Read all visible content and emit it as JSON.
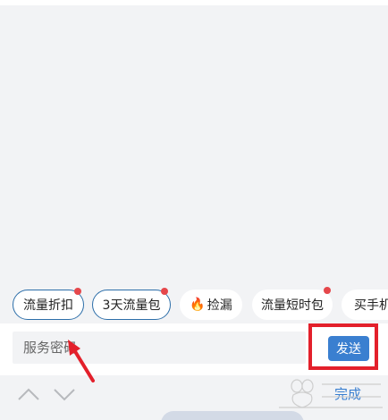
{
  "quick_replies": [
    {
      "label": "流量折扣",
      "has_dot": true
    },
    {
      "label": "3天流量包",
      "has_dot": true
    },
    {
      "label": "捡漏",
      "icon": "fire-icon"
    },
    {
      "label": "流量短时包",
      "has_dot": true
    },
    {
      "label": "买手机"
    }
  ],
  "input": {
    "placeholder": "服务密码",
    "value": ""
  },
  "send_button": {
    "label": "发送"
  },
  "toolbar": {
    "done_label": "完成"
  },
  "colors": {
    "accent": "#3a7fd0",
    "highlight": "#e3202b",
    "chip_border": "#2c6ea9",
    "dot": "#e5474b"
  }
}
